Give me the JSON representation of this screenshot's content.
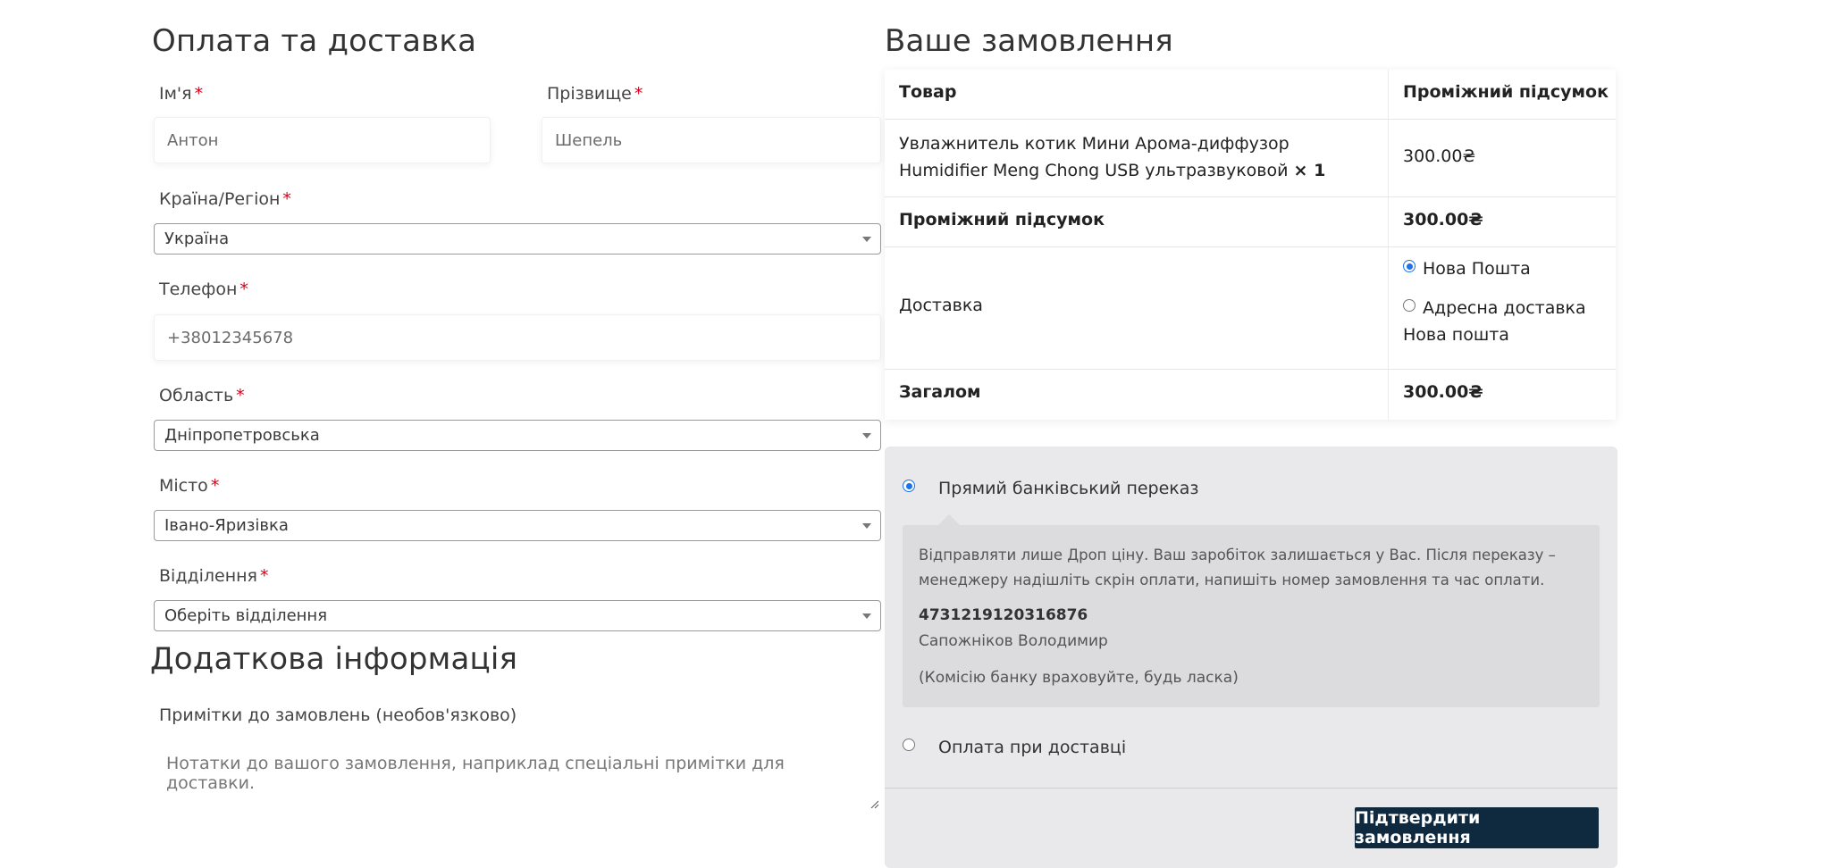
{
  "billing": {
    "title": "Оплата та доставка",
    "first_name": {
      "label": "Ім'я",
      "value": "Антон"
    },
    "last_name": {
      "label": "Прізвище",
      "value": "Шепель"
    },
    "country": {
      "label": "Країна/Регіон",
      "value": "Україна"
    },
    "phone": {
      "label": "Телефон",
      "value": "+38012345678"
    },
    "region": {
      "label": "Область",
      "value": "Дніпропетровська"
    },
    "city": {
      "label": "Місто",
      "value": "Івано-Яризівка"
    },
    "branch": {
      "label": "Відділення",
      "value": "Оберіть відділення"
    },
    "required_mark": "*"
  },
  "additional": {
    "title": "Додаткова інформація",
    "notes_label": "Примітки до замовлень (необов'язково)",
    "notes_placeholder": "Нотатки до вашого замовлення, наприклад спеціальні примітки для доставки."
  },
  "order": {
    "title": "Ваше замовлення",
    "col_product": "Товар",
    "col_subtotal": "Проміжний підсумок",
    "item_name": "Увлажнитель котик Мини Арома-диффузор Humidifier Meng Chong USB ультразвуковой",
    "item_qty": "× 1",
    "item_price": "300.00₴",
    "subtotal_label": "Проміжний підсумок",
    "subtotal_value": "300.00₴",
    "shipping_label": "Доставка",
    "shipping_options": [
      "Нова Пошта",
      "Адресна доставка Нова пошта"
    ],
    "shipping_selected": 0,
    "total_label": "Загалом",
    "total_value": "300.00₴"
  },
  "payment": {
    "bank_transfer_label": "Прямий банківський переказ",
    "bank_info_text": "Відправляти лише Дроп ціну. Ваш заробіток залишається у Вас. Після переказу – менеджеру надішліть скрін оплати, напишіть номер замовлення та час оплати.",
    "card_number": "4731219120316876",
    "card_holder": "Сапожніков Володимир",
    "note": "(Комісію банку враховуйте, будь ласка)",
    "cod_label": "Оплата при доставці",
    "selected": "bank_transfer",
    "submit_label": "Підтвердити замовлення",
    "accent_color": "#1a73e8",
    "button_color": "#0f2a3e"
  }
}
